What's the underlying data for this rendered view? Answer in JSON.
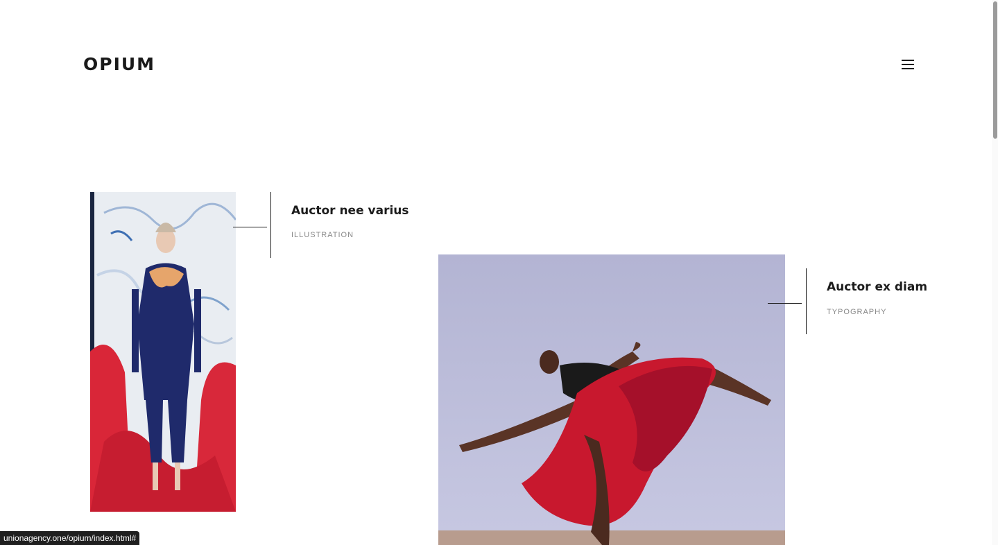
{
  "header": {
    "logo": "OPIUM",
    "menu_icon": "hamburger-menu-icon"
  },
  "portfolio": {
    "items": [
      {
        "title": "Auctor nee varius",
        "category": "ILLUSTRATION",
        "image": "fashion-model-photo"
      },
      {
        "title": "Auctor ex diam",
        "category": "TYPOGRAPHY",
        "image": "dancer-red-fabric-photo"
      }
    ]
  },
  "status_bar": {
    "url": "unionagency.one/opium/index.html#"
  },
  "colors": {
    "text": "#1c1c1c",
    "muted": "#888888",
    "accent_red": "#c8182e",
    "backdrop_lavender": "#b9b8d6"
  }
}
